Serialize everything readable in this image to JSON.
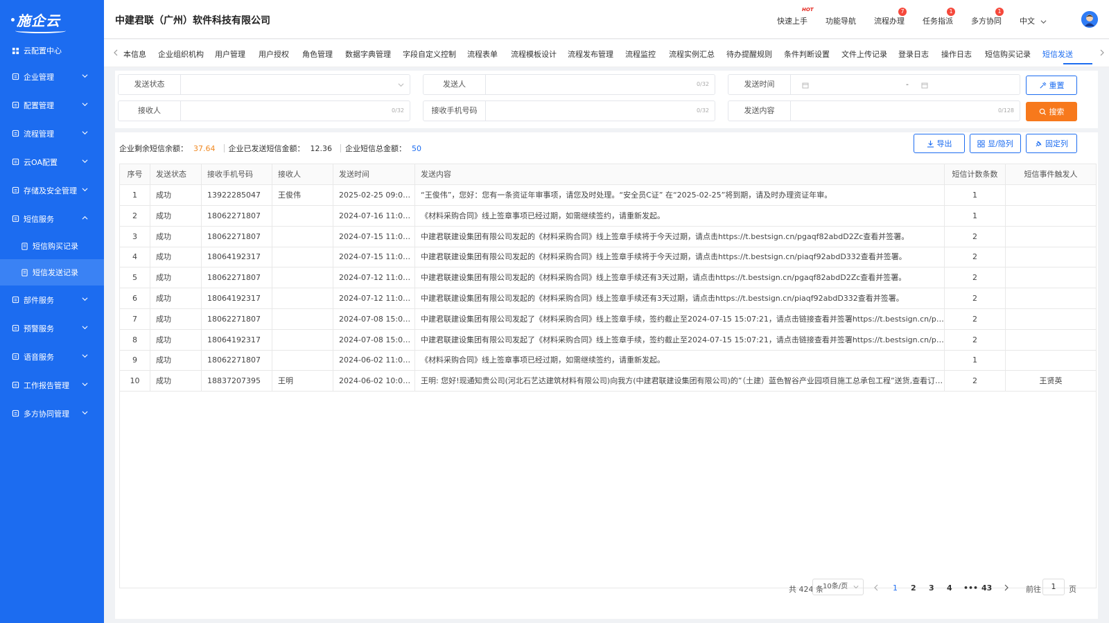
{
  "sidebar": {
    "logo": "施企云",
    "items": [
      {
        "label": "云配置中心",
        "icon": "grid-icon"
      },
      {
        "label": "企业管理",
        "icon": "building-icon"
      },
      {
        "label": "配置管理",
        "icon": "layers-icon"
      },
      {
        "label": "流程管理",
        "icon": "flow-icon"
      },
      {
        "label": "云OA配置",
        "icon": "user-gear-icon"
      },
      {
        "label": "存储及安全管理",
        "icon": "storage-icon"
      },
      {
        "label": "短信服务",
        "icon": "mail-icon"
      },
      {
        "label": "部件服务",
        "icon": "component-icon"
      },
      {
        "label": "预警服务",
        "icon": "warning-icon"
      },
      {
        "label": "语音服务",
        "icon": "voice-icon"
      },
      {
        "label": "工作报告管理",
        "icon": "report-icon"
      },
      {
        "label": "多方协同管理",
        "icon": "collab-icon"
      }
    ],
    "subitems": [
      {
        "label": "短信购买记录"
      },
      {
        "label": "短信发送记录"
      }
    ]
  },
  "header": {
    "company": "中建君联（广州）软件科技有限公司",
    "nav": [
      {
        "label": "快速上手",
        "badge": "HOT"
      },
      {
        "label": "功能导航",
        "badge": ""
      },
      {
        "label": "流程办理",
        "badge": "7"
      },
      {
        "label": "任务指派",
        "badge": "1"
      },
      {
        "label": "多方协同",
        "badge": "1"
      }
    ],
    "language": "中文"
  },
  "tabs": [
    "本信息",
    "企业组织机构",
    "用户管理",
    "用户授权",
    "角色管理",
    "数据字典管理",
    "字段自定义控制",
    "流程表单",
    "流程模板设计",
    "流程发布管理",
    "流程监控",
    "流程实例汇总",
    "待办提醒规则",
    "条件判断设置",
    "文件上传记录",
    "登录日志",
    "操作日志",
    "短信购买记录",
    "短信发送"
  ],
  "filters": {
    "send_status": {
      "label": "发送状态",
      "value": ""
    },
    "sender": {
      "label": "发送人",
      "count": "0/32"
    },
    "send_time": {
      "label": "发送时间",
      "sep": "-"
    },
    "receiver": {
      "label": "接收人",
      "count": "0/32"
    },
    "receiver_phone": {
      "label": "接收手机号码",
      "count": "0/32"
    },
    "content": {
      "label": "发送内容",
      "count": "0/128"
    },
    "reset_label": "重置",
    "search_label": "搜索"
  },
  "stats": {
    "remaining_label": "企业剩余短信余额：",
    "remaining_value": "37.64",
    "sent_label": "企业已发送短信金额：",
    "sent_value": "12.36",
    "total_label": "企业短信总金额：",
    "total_value": "50"
  },
  "toolbar": {
    "export_label": "导出",
    "toggle_label": "显/隐列",
    "fix_label": "固定列"
  },
  "table": {
    "headers": [
      "序号",
      "发送状态",
      "接收手机号码",
      "接收人",
      "发送时间",
      "发送内容",
      "短信计数条数",
      "短信事件触发人"
    ],
    "rows": [
      [
        "1",
        "成功",
        "13922285047",
        "王俊伟",
        "2025-02-25 09:00:...",
        "“王俊伟”，您好：您有一条资证年审事项，请您及时处理。“安全员C证” 在“2025-02-25”将到期，请及时办理资证年审。",
        "1",
        ""
      ],
      [
        "2",
        "成功",
        "18062271807",
        "",
        "2024-07-16 11:00:00",
        "《材料采购合同》线上签章事项已经过期，如需继续签约，请重新发起。",
        "1",
        ""
      ],
      [
        "3",
        "成功",
        "18062271807",
        "",
        "2024-07-15 11:00:00",
        "中建君联建设集团有限公司发起的《材料采购合同》线上签章手续将于今天过期，请点击https://t.bestsign.cn/pgaqf82abdD2Zc查看并签署。",
        "2",
        ""
      ],
      [
        "4",
        "成功",
        "18064192317",
        "",
        "2024-07-15 11:00:00",
        "中建君联建设集团有限公司发起的《材料采购合同》线上签章手续将于今天过期，请点击https://t.bestsign.cn/piaqf92abdD332查看并签署。",
        "2",
        ""
      ],
      [
        "5",
        "成功",
        "18062271807",
        "",
        "2024-07-12 11:00:00",
        "中建君联建设集团有限公司发起的《材料采购合同》线上签章手续还有3天过期，请点击https://t.bestsign.cn/pgaqf82abdD2Zc查看并签署。",
        "2",
        ""
      ],
      [
        "6",
        "成功",
        "18064192317",
        "",
        "2024-07-12 11:00:00",
        "中建君联建设集团有限公司发起的《材料采购合同》线上签章手续还有3天过期，请点击https://t.bestsign.cn/piaqf92abdD332查看并签署。",
        "2",
        ""
      ],
      [
        "7",
        "成功",
        "18062271807",
        "",
        "2024-07-08 15:07:22",
        "中建君联建设集团有限公司发起了《材料采购合同》线上签章手续，签约截止至2024-07-15 15:07:21，请点击链接查看并签署https://t.bestsign.cn/pgaqf82abd...",
        "2",
        ""
      ],
      [
        "8",
        "成功",
        "18064192317",
        "",
        "2024-07-08 15:07:22",
        "中建君联建设集团有限公司发起了《材料采购合同》线上签章手续，签约截止至2024-07-15 15:07:21，请点击链接查看并签署https://t.bestsign.cn/piaqf92abdD...",
        "2",
        ""
      ],
      [
        "9",
        "成功",
        "18062271807",
        "",
        "2024-06-02 11:00:00",
        "《材料采购合同》线上签章事项已经过期，如需继续签约，请重新发起。",
        "1",
        ""
      ],
      [
        "10",
        "成功",
        "18837207395",
        "王明",
        "2024-06-02 10:02:...",
        "王明: 您好!现通知贵公司(河北石艺达建筑材料有限公司)向我方(中建君联建设集团有限公司)的”（土建）蓝色智谷产业园项目施工总承包工程”送货,查看订单详情,请点...",
        "2",
        "王贤英"
      ]
    ]
  },
  "pagination": {
    "total": "共 424 条",
    "page_size": "10条/页",
    "pages": [
      "1",
      "2",
      "3",
      "4",
      "•••",
      "43"
    ],
    "goto_label": "前往",
    "goto_value": "1",
    "page_unit": "页"
  },
  "colors": {
    "primary": "#1c6cf0",
    "orange": "#f7791c",
    "badge": "#f5483b"
  }
}
